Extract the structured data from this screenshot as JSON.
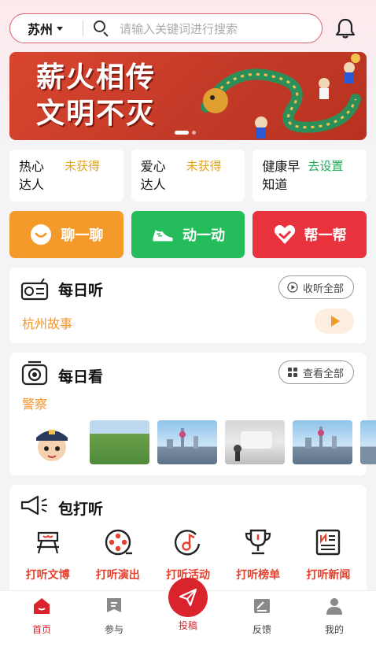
{
  "header": {
    "city": "苏州",
    "search_placeholder": "请输入关键词进行搜索"
  },
  "banner": {
    "line1": "薪火相传",
    "line2": "文明不灭"
  },
  "badges": [
    {
      "label": "热心达人",
      "status": "未获得"
    },
    {
      "label": "爱心达人",
      "status": "未获得"
    },
    {
      "label": "健康早知道",
      "status": "去设置"
    }
  ],
  "actions": [
    {
      "label": "聊一聊",
      "icon": "chat-icon",
      "color": "#f39a2b"
    },
    {
      "label": "动一动",
      "icon": "shoe-icon",
      "color": "#25bd5c"
    },
    {
      "label": "帮一帮",
      "icon": "heart-hand-icon",
      "color": "#e8323d"
    }
  ],
  "daily_listen": {
    "title": "每日听",
    "button": "收听全部",
    "item": "杭州故事"
  },
  "daily_watch": {
    "title": "每日看",
    "button": "查看全部",
    "category": "警察"
  },
  "inquire": {
    "title": "包打听",
    "items": [
      {
        "label": "打听文博",
        "icon": "museum-icon"
      },
      {
        "label": "打听演出",
        "icon": "film-reel-icon"
      },
      {
        "label": "打听活动",
        "icon": "music-note-icon"
      },
      {
        "label": "打听榜单",
        "icon": "trophy-icon"
      },
      {
        "label": "打听新闻",
        "icon": "newspaper-icon"
      }
    ]
  },
  "tabbar": {
    "items": [
      {
        "label": "首页",
        "icon": "home-icon",
        "active": true
      },
      {
        "label": "参与",
        "icon": "bookmark-icon"
      },
      {
        "label": "投稿",
        "icon": "paper-plane-icon"
      },
      {
        "label": "反馈",
        "icon": "feedback-icon"
      },
      {
        "label": "我的",
        "icon": "user-icon"
      }
    ]
  },
  "colors": {
    "brand_red": "#d9232d",
    "accent_orange": "#f0962f",
    "status_yellow": "#e5a417",
    "status_green": "#1faa55"
  }
}
